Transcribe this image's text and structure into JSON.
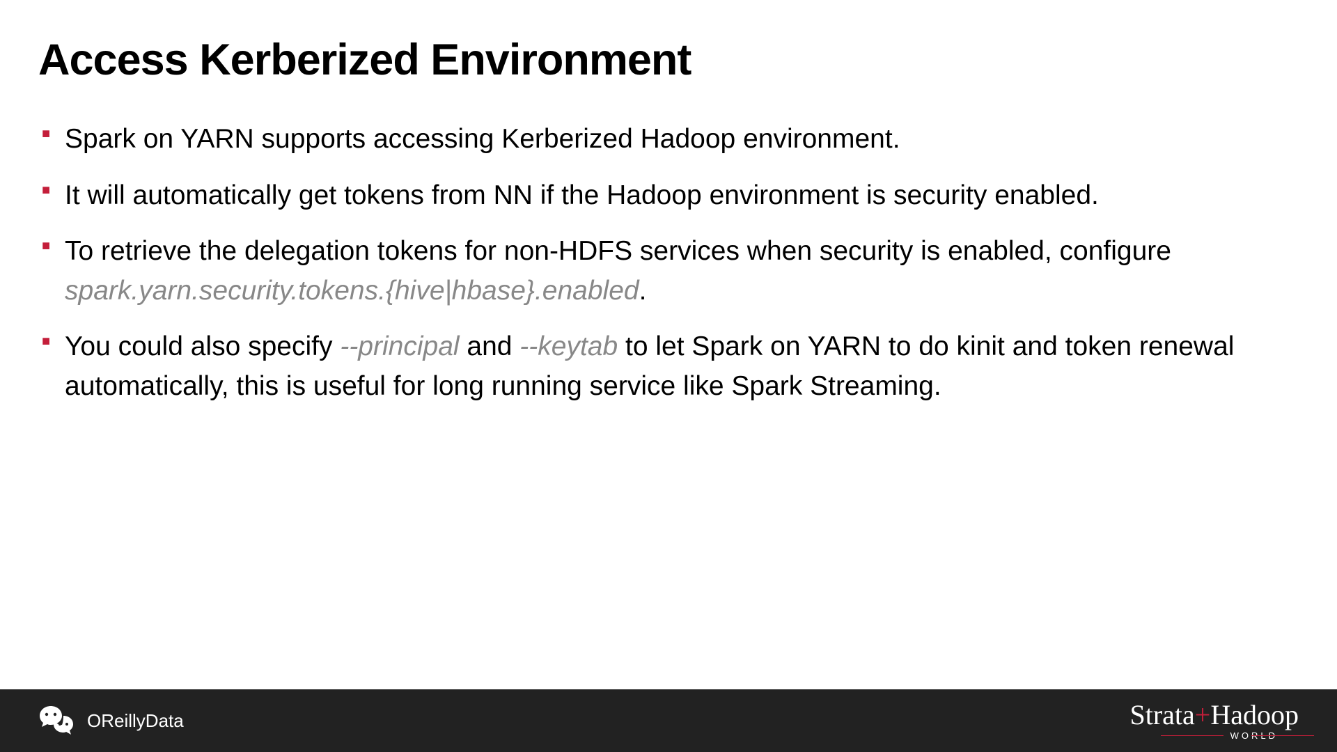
{
  "slide": {
    "title": "Access Kerberized Environment",
    "bullets": [
      {
        "text_before": "Spark on YARN supports accessing Kerberized Hadoop environment.",
        "italic_1": "",
        "text_mid": "",
        "italic_2": "",
        "text_after": ""
      },
      {
        "text_before": "It will automatically get tokens from NN if the Hadoop environment is security enabled.",
        "italic_1": "",
        "text_mid": "",
        "italic_2": "",
        "text_after": ""
      },
      {
        "text_before": "To retrieve the delegation tokens for non-HDFS services when security is enabled, configure ",
        "italic_1": "spark.yarn.security.tokens.{hive|hbase}.enabled",
        "text_mid": ".",
        "italic_2": "",
        "text_after": ""
      },
      {
        "text_before": "You could also specify ",
        "italic_1": "--principal",
        "text_mid": " and ",
        "italic_2": "--keytab",
        "text_after": " to let Spark on YARN to do kinit and token renewal automatically, this is useful for long running service like Spark Streaming."
      }
    ]
  },
  "footer": {
    "left_text": "OReillyData",
    "right_main_1": "Strata",
    "right_main_plus": "+",
    "right_main_2": "Hadoop",
    "right_sub": "WORLD"
  }
}
